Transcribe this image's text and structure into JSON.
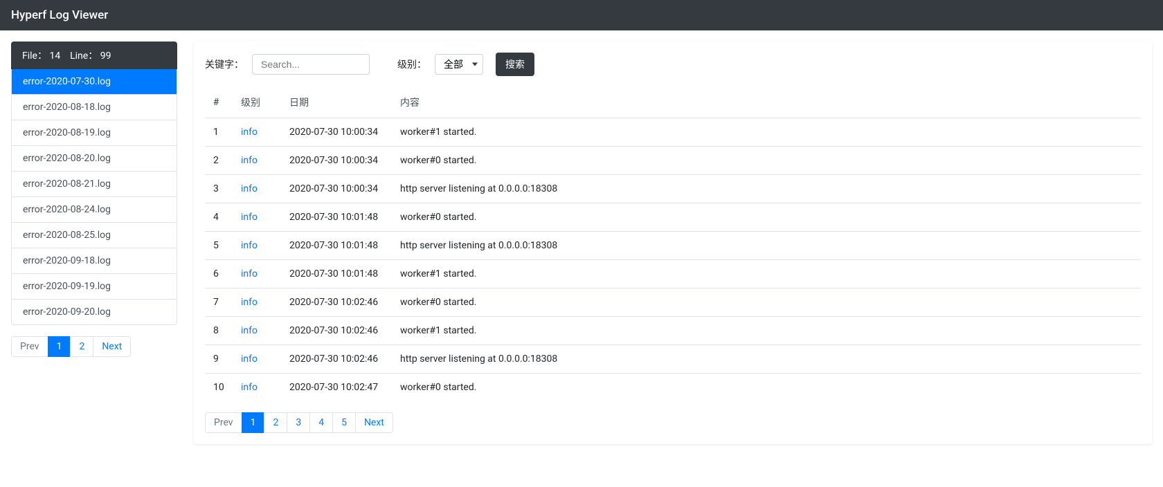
{
  "navbar": {
    "title": "Hyperf Log Viewer"
  },
  "sidebar": {
    "header": {
      "file_label": "File：",
      "file_count": "14",
      "line_label": "Line：",
      "line_count": "99"
    },
    "files": [
      {
        "name": "error-2020-07-30.log",
        "active": true
      },
      {
        "name": "error-2020-08-18.log",
        "active": false
      },
      {
        "name": "error-2020-08-19.log",
        "active": false
      },
      {
        "name": "error-2020-08-20.log",
        "active": false
      },
      {
        "name": "error-2020-08-21.log",
        "active": false
      },
      {
        "name": "error-2020-08-24.log",
        "active": false
      },
      {
        "name": "error-2020-08-25.log",
        "active": false
      },
      {
        "name": "error-2020-09-18.log",
        "active": false
      },
      {
        "name": "error-2020-09-19.log",
        "active": false
      },
      {
        "name": "error-2020-09-20.log",
        "active": false
      }
    ],
    "pagination": [
      {
        "label": "Prev",
        "state": "disabled"
      },
      {
        "label": "1",
        "state": "active"
      },
      {
        "label": "2",
        "state": ""
      },
      {
        "label": "Next",
        "state": ""
      }
    ]
  },
  "filter": {
    "keyword_label": "关键字：",
    "search_placeholder": "Search...",
    "level_label": "级别：",
    "level_selected": "全部",
    "search_button": "搜索"
  },
  "table": {
    "headers": {
      "index": "#",
      "level": "级别",
      "date": "日期",
      "content": "内容"
    },
    "rows": [
      {
        "index": "1",
        "level": "info",
        "date": "2020-07-30 10:00:34",
        "content": "worker#1 started."
      },
      {
        "index": "2",
        "level": "info",
        "date": "2020-07-30 10:00:34",
        "content": "worker#0 started."
      },
      {
        "index": "3",
        "level": "info",
        "date": "2020-07-30 10:00:34",
        "content": "http server listening at 0.0.0.0:18308"
      },
      {
        "index": "4",
        "level": "info",
        "date": "2020-07-30 10:01:48",
        "content": "worker#0 started."
      },
      {
        "index": "5",
        "level": "info",
        "date": "2020-07-30 10:01:48",
        "content": "http server listening at 0.0.0.0:18308"
      },
      {
        "index": "6",
        "level": "info",
        "date": "2020-07-30 10:01:48",
        "content": "worker#1 started."
      },
      {
        "index": "7",
        "level": "info",
        "date": "2020-07-30 10:02:46",
        "content": "worker#0 started."
      },
      {
        "index": "8",
        "level": "info",
        "date": "2020-07-30 10:02:46",
        "content": "worker#1 started."
      },
      {
        "index": "9",
        "level": "info",
        "date": "2020-07-30 10:02:46",
        "content": "http server listening at 0.0.0.0:18308"
      },
      {
        "index": "10",
        "level": "info",
        "date": "2020-07-30 10:02:47",
        "content": "worker#0 started."
      }
    ],
    "pagination": [
      {
        "label": "Prev",
        "state": "disabled"
      },
      {
        "label": "1",
        "state": "active"
      },
      {
        "label": "2",
        "state": ""
      },
      {
        "label": "3",
        "state": ""
      },
      {
        "label": "4",
        "state": ""
      },
      {
        "label": "5",
        "state": ""
      },
      {
        "label": "Next",
        "state": ""
      }
    ]
  }
}
